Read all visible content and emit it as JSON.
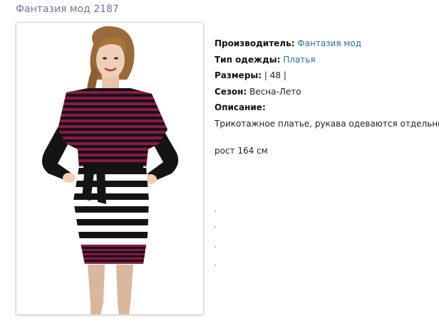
{
  "product": {
    "title": "Фантазия мод 2187",
    "photo_alt": "Модель в трикотажном платье в полоску"
  },
  "details": {
    "manufacturer_label": "Производитель:",
    "manufacturer_value": "Фантазия мод",
    "clothing_type_label": "Тип одежды:",
    "clothing_type_value": "Платья",
    "sizes_label": "Размеры:",
    "sizes_value": "| 48 |",
    "season_label": "Сезон:",
    "season_value": "Весна-Лето",
    "description_label": "Описание:",
    "description_text": "Трикотажное платье, рукава одеваются отдельно",
    "height_text": "рост 164 см"
  },
  "colors": {
    "title": "#7a6f93",
    "link": "#2f6f8f",
    "dress_magenta": "#8a1848",
    "dress_black": "#141414"
  }
}
